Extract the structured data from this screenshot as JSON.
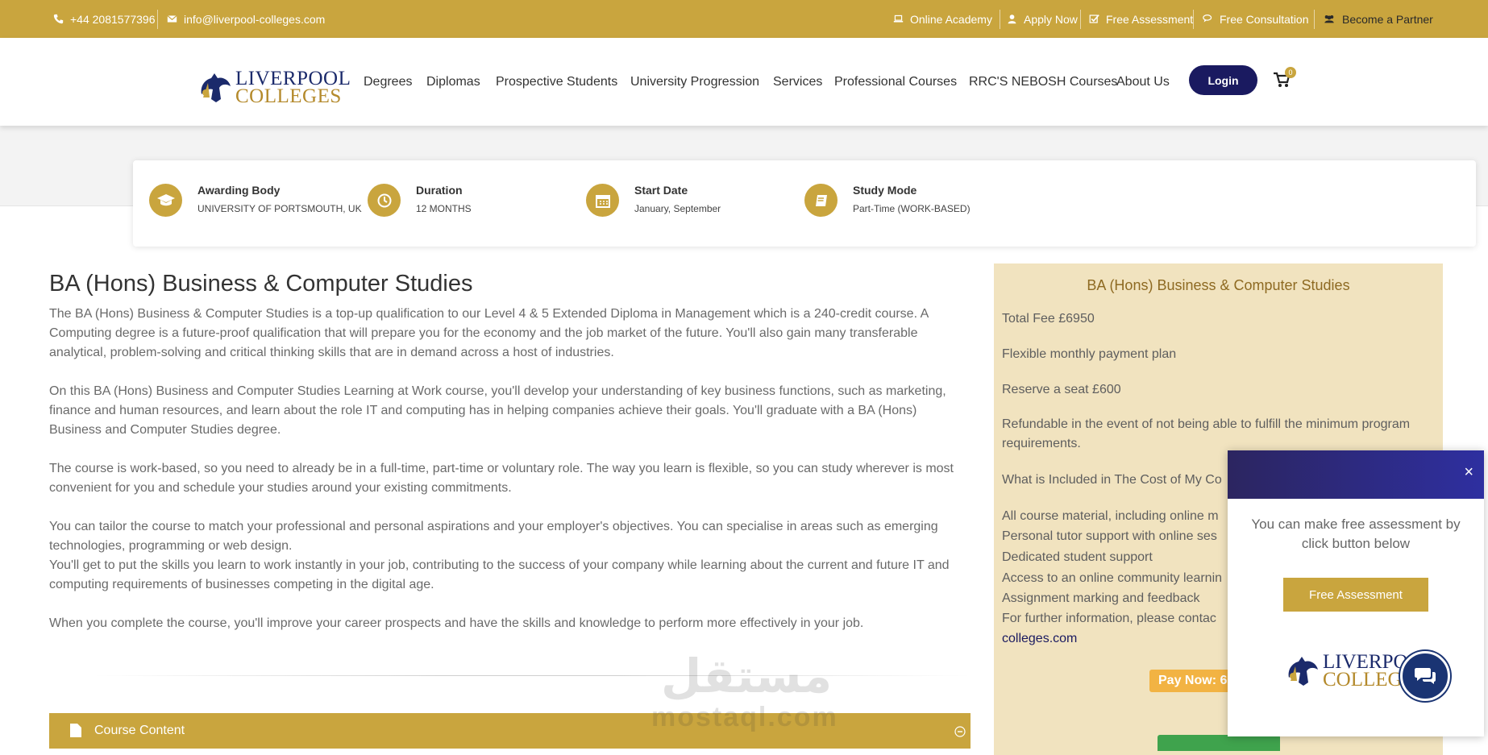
{
  "topbar": {
    "phone": "+44 2081577396",
    "email": "info@liverpool-colleges.com",
    "links": [
      "Online Academy",
      "Apply Now",
      "Free Assessment",
      "Free Consultation",
      "Become a Partner"
    ]
  },
  "header": {
    "logo_line1": "LIVERPOOL",
    "logo_line2": "COLLEGES",
    "nav": [
      "Degrees",
      "Diplomas",
      "Prospective Students",
      "University Progression",
      "Services",
      "Professional Courses",
      "RRC'S NEBOSH Courses",
      "About Us"
    ],
    "login_label": "Login",
    "cart_count": "0"
  },
  "info": [
    {
      "title": "Awarding Body",
      "value": "UNIVERSITY OF PORTSMOUTH, UK",
      "icon": "graduation-cap-icon"
    },
    {
      "title": "Duration",
      "value": "12 MONTHS",
      "icon": "clock-icon"
    },
    {
      "title": "Start Date",
      "value": "January, September",
      "icon": "calendar-icon"
    },
    {
      "title": "Study Mode",
      "value": "Part-Time  (WORK-BASED)",
      "icon": "book-icon"
    }
  ],
  "main": {
    "title": "BA (Hons) Business & Computer Studies",
    "paragraphs": [
      "The BA (Hons) Business & Computer Studies is a top-up qualification to our Level 4 & 5 Extended Diploma in Management which is a 240-credit course. A Computing degree is a future-proof qualification that will prepare you for the economy and the job market of the future. You'll also gain many transferable analytical, problem-solving and critical thinking skills that are in demand across a host of industries.",
      "On this BA (Hons) Business and Computer Studies Learning at Work course, you'll develop your understanding of key business functions, such as marketing, finance and human resources, and learn about the role IT and computing has in helping companies achieve their goals. You'll graduate with a BA (Hons) Business and Computer Studies degree.",
      "The course is work-based, so you need to already be in a full-time, part-time or voluntary role. The way you learn is flexible, so you can study wherever is most convenient for you and schedule your studies around your existing commitments.",
      "You can tailor the course to match your professional and personal aspirations and your employer's objectives. You can specialise in areas such as emerging technologies, programming or web design.",
      "You'll get to put the skills you learn to work instantly in your job, contributing to the success of your company while learning about the current and future IT and computing requirements of businesses competing in the digital age.",
      "When you complete the course, you'll improve your career prospects and have the skills and knowledge to perform more effectively in your job."
    ],
    "course_content_label": "Course Content"
  },
  "panel": {
    "title": "BA (Hons) Business & Computer Studies",
    "total_fee": "Total Fee £6950",
    "payment_plan": "Flexible monthly payment plan",
    "reserve": "Reserve a seat  £600",
    "refundable": "Refundable in the event of not being able to fulfill the minimum program requirements.",
    "included_heading": "What is Included in The Cost of My Co",
    "included": [
      "All course material, including online m",
      "Personal tutor support with online ses",
      "Dedicated student support",
      "Access to an online community learnin",
      "Assignment marking and feedback",
      "For further information, please contac"
    ],
    "link_text": "colleges.com",
    "pay_now": "Pay Now: 6"
  },
  "popup": {
    "message": "You can make free assessment by click button below",
    "button_label": "Free Assessment",
    "close_label": "×",
    "logo_line1": "LIVERPOOL",
    "logo_line2": "COLLEGES"
  },
  "watermark": {
    "arabic": "مستقل",
    "latin": "mostaql.com"
  },
  "colors": {
    "gold": "#c9a53e",
    "navy": "#1a1a60",
    "panel_bg": "#f1e3bf",
    "pay_orange": "#f2b343"
  }
}
